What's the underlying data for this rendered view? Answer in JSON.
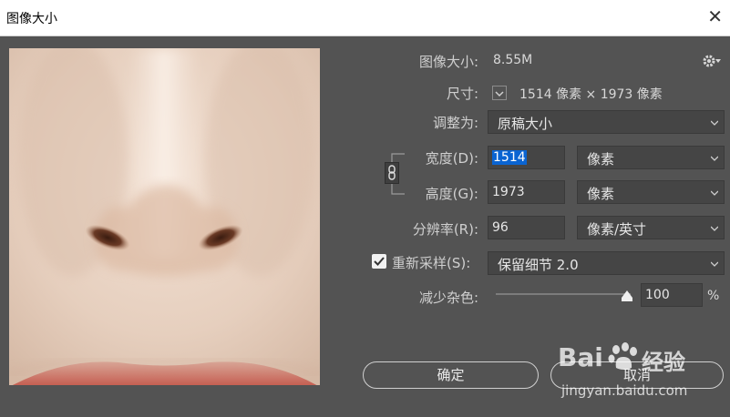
{
  "window": {
    "title": "图像大小",
    "close_glyph": "✕"
  },
  "info": {
    "size_label": "图像大小:",
    "size_value": "8.55M"
  },
  "dimensions": {
    "label": "尺寸:",
    "value": "1514 像素  ×  1973 像素"
  },
  "fit": {
    "label": "调整为:",
    "value": "原稿大小"
  },
  "width": {
    "label": "宽度(D):",
    "value": "1514",
    "unit": "像素"
  },
  "height": {
    "label": "高度(G):",
    "value": "1973",
    "unit": "像素"
  },
  "resolution": {
    "label": "分辨率(R):",
    "value": "96",
    "unit": "像素/英寸"
  },
  "resample": {
    "checked": true,
    "label": "重新采样(S):",
    "method": "保留细节 2.0"
  },
  "noise": {
    "label": "减少杂色:",
    "value": "100",
    "unit": "%",
    "level": 1.0
  },
  "buttons": {
    "ok": "确定",
    "cancel": "取消"
  },
  "watermark": {
    "brand": "Bai",
    "brand_suffix": "经验",
    "url": "jingyan.baidu.com"
  },
  "colors": {
    "panel": "#535353",
    "accent_checkbox": "#ffffff",
    "highlight": "#0a64d2"
  }
}
